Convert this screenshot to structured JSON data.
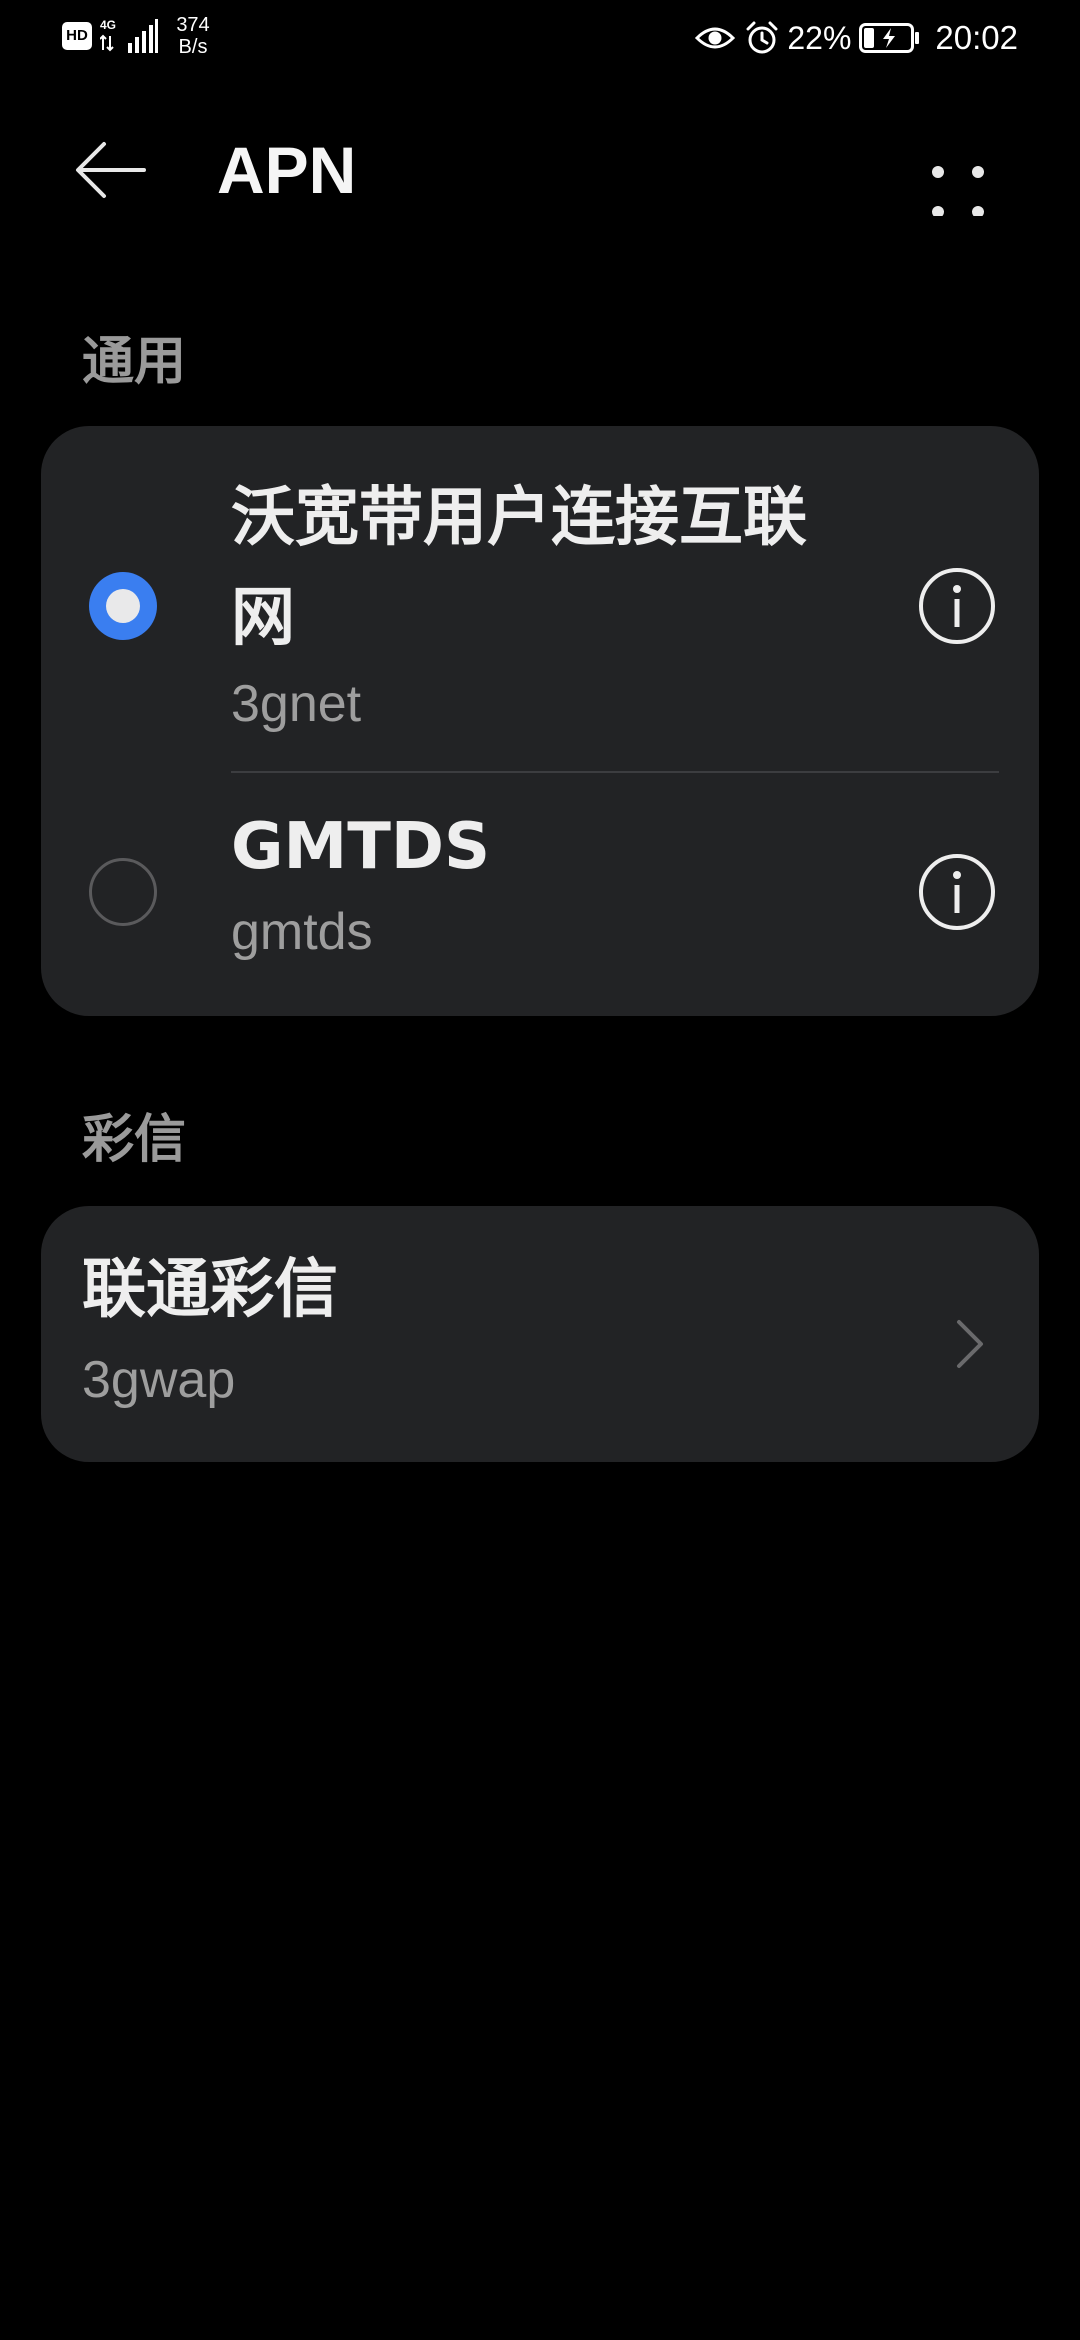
{
  "status_bar": {
    "hd_badge": "HD",
    "network_type": "4G",
    "speed_value": "374",
    "speed_unit": "B/s",
    "battery_percent": "22%",
    "time": "20:02",
    "icons": [
      "hd-icon",
      "signal-icon",
      "eye-icon",
      "alarm-icon",
      "battery-charging-icon"
    ]
  },
  "app_bar": {
    "title": "APN",
    "back_icon": "arrow-left-icon",
    "more_icon": "more-dots-icon"
  },
  "sections": {
    "general": {
      "header": "通用",
      "items": [
        {
          "title": "沃宽带用户连接互联网",
          "subtitle": "3gnet",
          "selected": true
        },
        {
          "title": "GMTDS",
          "subtitle": "gmtds",
          "selected": false
        }
      ]
    },
    "mms": {
      "header": "彩信",
      "items": [
        {
          "title": "联通彩信",
          "subtitle": "3gwap"
        }
      ]
    }
  },
  "colors": {
    "background": "#000000",
    "card": "#222325",
    "accent": "#3a7ef0",
    "primary_text": "#eeeeee",
    "secondary_text": "#9e9e9e"
  }
}
